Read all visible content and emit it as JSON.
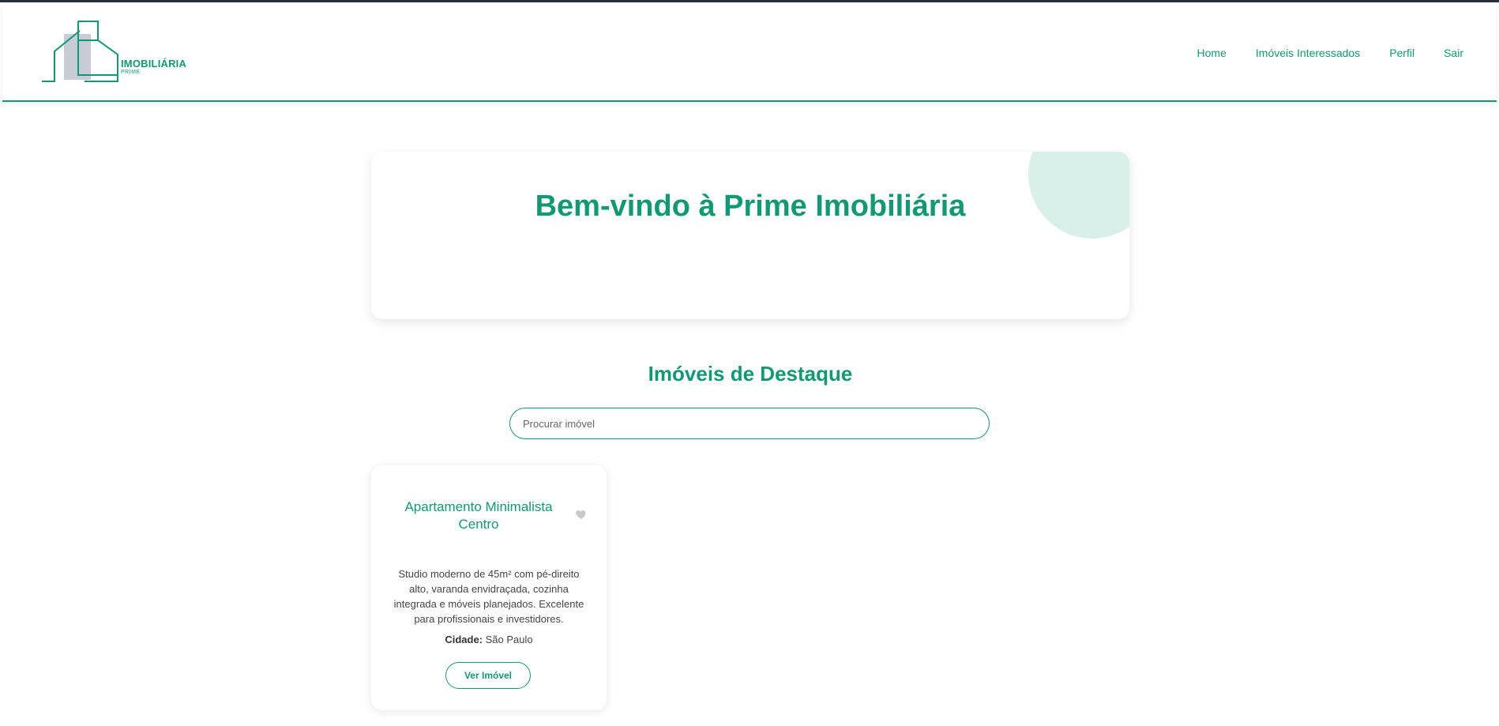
{
  "brand": {
    "name": "IMOBILIÁRIA",
    "sub": "PRIME"
  },
  "nav": [
    {
      "label": "Home"
    },
    {
      "label": "Imóveis Interessados"
    },
    {
      "label": "Perfil"
    },
    {
      "label": "Sair"
    }
  ],
  "hero": {
    "title": "Bem-vindo à Prime Imobiliária"
  },
  "featured": {
    "title": "Imóveis de Destaque",
    "search_placeholder": "Procurar imóvel"
  },
  "listings": [
    {
      "title": "Apartamento Minimalista Centro",
      "description": "Studio moderno de 45m² com pé-direito alto, varanda envidraçada, cozinha integrada e móveis planejados. Excelente para profissionais e investidores.",
      "city_label": "Cidade:",
      "city": "São Paulo",
      "button_label": "Ver Imóvel",
      "favorite_icon": "heart-icon"
    }
  ],
  "colors": {
    "accent": "#0f9a74",
    "accent_light": "#d9f0ea",
    "logo_gray": "#c8ccd6"
  }
}
